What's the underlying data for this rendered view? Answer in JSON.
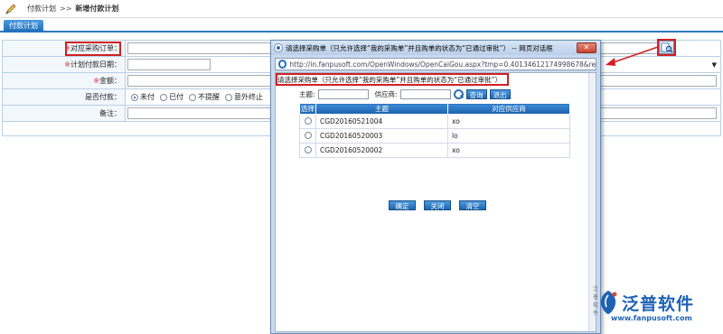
{
  "breadcrumb": {
    "parent": "付款计划",
    "separator": ">>",
    "current": "新增付款计划"
  },
  "tab": {
    "label": "付款计划"
  },
  "form": {
    "required_mark": "※",
    "purchase_order_label": "对应采购订单：",
    "plan_date_label": "计划付款日期：",
    "amount_label": "金额：",
    "paid_label": "是否付款：",
    "paid_options": [
      "未付",
      "已付",
      "不提醒",
      "意外终止"
    ],
    "paid_selected": "未付",
    "note_label": "备注："
  },
  "dialog": {
    "title": "请选择采购单（只允许选择“我的采购单”并且购单的状态为“已通过审批”） -- 网页对话框",
    "url": "http://in.fanpusoft.com/OpenWindows/OpenCaiGou.aspx?tmp=0.40134612174998678&requeststr=",
    "heading": "请选择采购单（只允许选择“我的采购单”并且购单的状态为“已通过审批”）",
    "filter_subject_label": "主题:",
    "filter_supplier_label": "供应商:",
    "query_button": "查询",
    "exit_button": "退出",
    "columns": [
      "选择",
      "主题",
      "对应供应商"
    ],
    "rows": [
      {
        "subject": "CGD20160521004",
        "supplier": "xo"
      },
      {
        "subject": "CGD20160520003",
        "supplier": "lo"
      },
      {
        "subject": "CGD20160520002",
        "supplier": "xo"
      }
    ],
    "ok_button": "确定",
    "close_button": "关闭",
    "clear_button": "清空",
    "watermark": "泛普软件"
  },
  "logo": {
    "brand": "泛普软件",
    "site": "www.fanpusoft.com"
  },
  "colors": {
    "accent": "#1f62b4",
    "highlight": "#d32020",
    "required": "#e03030"
  }
}
